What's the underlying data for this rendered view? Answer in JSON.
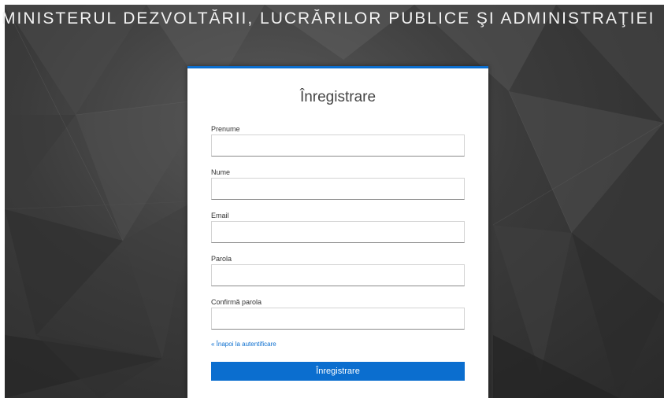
{
  "header": {
    "title": "MINISTERUL DEZVOLTĂRII, LUCRĂRILOR PUBLICE ŞI ADMINISTRAŢIEI"
  },
  "form": {
    "title": "Înregistrare",
    "fields": [
      {
        "label": "Prenume",
        "value": "",
        "placeholder": ""
      },
      {
        "label": "Nume",
        "value": "",
        "placeholder": ""
      },
      {
        "label": "Email",
        "value": "",
        "placeholder": ""
      },
      {
        "label": "Parola",
        "value": "",
        "placeholder": ""
      },
      {
        "label": "Confirmă parola",
        "value": "",
        "placeholder": ""
      }
    ],
    "back_link": "« Înapoi la autentificare",
    "submit_label": "Înregistrare"
  },
  "colors": {
    "accent": "#0b6ecf",
    "background_dark": "#2a2a2a",
    "card": "#ffffff"
  }
}
